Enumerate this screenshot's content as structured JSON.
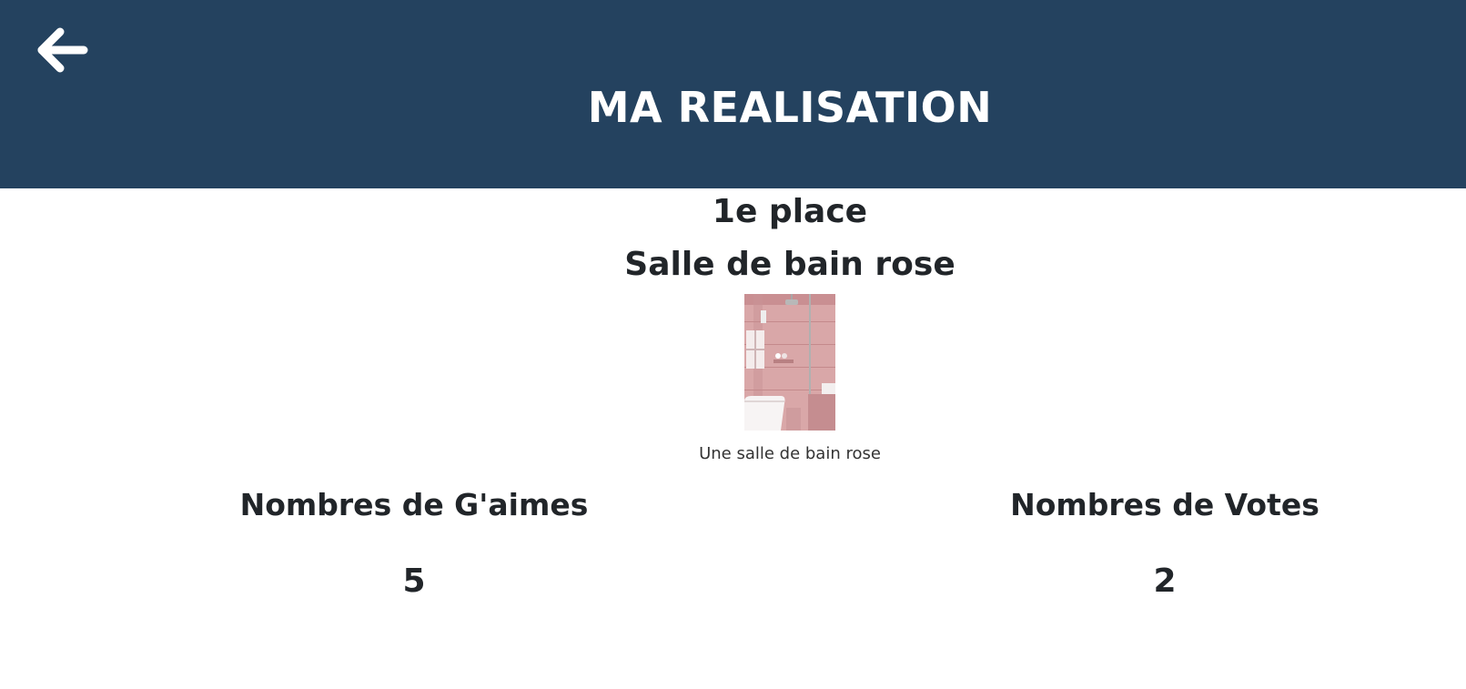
{
  "header": {
    "title": "MA REALISATION",
    "back_icon": "arrow-left-icon",
    "background_color": "#24425f"
  },
  "entry": {
    "rank": "1e place",
    "title": "Salle de bain rose",
    "image_alt": "Une salle de bain rose",
    "caption": "Une salle de bain rose"
  },
  "stats": {
    "likes_label": "Nombres de G'aimes",
    "likes_value": "5",
    "votes_label": "Nombres de Votes",
    "votes_value": "2"
  }
}
